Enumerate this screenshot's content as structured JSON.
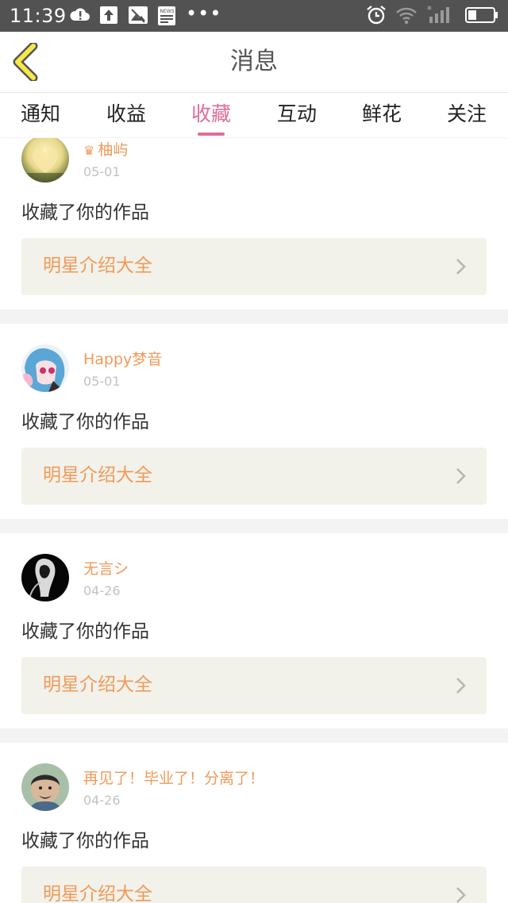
{
  "status_bar": {
    "time": "11:39",
    "dots": "•••",
    "icons": [
      "cloud-alert-icon",
      "upload-icon",
      "image-icon",
      "news-icon",
      "alarm-icon",
      "wifi-icon",
      "signal-icon",
      "battery-icon"
    ],
    "news_label": "NEWS"
  },
  "header": {
    "title": "消息",
    "back_icon": "chevron-left-icon",
    "accent_color": "#f6e84a"
  },
  "tabs": [
    {
      "label": "通知",
      "active": false
    },
    {
      "label": "收益",
      "active": false
    },
    {
      "label": "收藏",
      "active": true
    },
    {
      "label": "互动",
      "active": false
    },
    {
      "label": "鲜花",
      "active": false
    },
    {
      "label": "关注",
      "active": false
    }
  ],
  "notifications": [
    {
      "user": "柚屿",
      "badge_icon": "crown-icon",
      "date": "05-01",
      "action": "收藏了你的作品",
      "work_title": "明星介绍大全"
    },
    {
      "user": "Happy梦音",
      "date": "05-01",
      "action": "收藏了你的作品",
      "work_title": "明星介绍大全"
    },
    {
      "user": "无言シ",
      "date": "04-26",
      "action": "收藏了你的作品",
      "work_title": "明星介绍大全"
    },
    {
      "user": "再见了！毕业了！分离了！",
      "date": "04-26",
      "action": "收藏了你的作品",
      "work_title": "明星介绍大全"
    }
  ],
  "colors": {
    "accent_pink": "#e06c9a",
    "username_orange": "#ef9a5a",
    "card_box_bg": "#f2f2ea"
  }
}
